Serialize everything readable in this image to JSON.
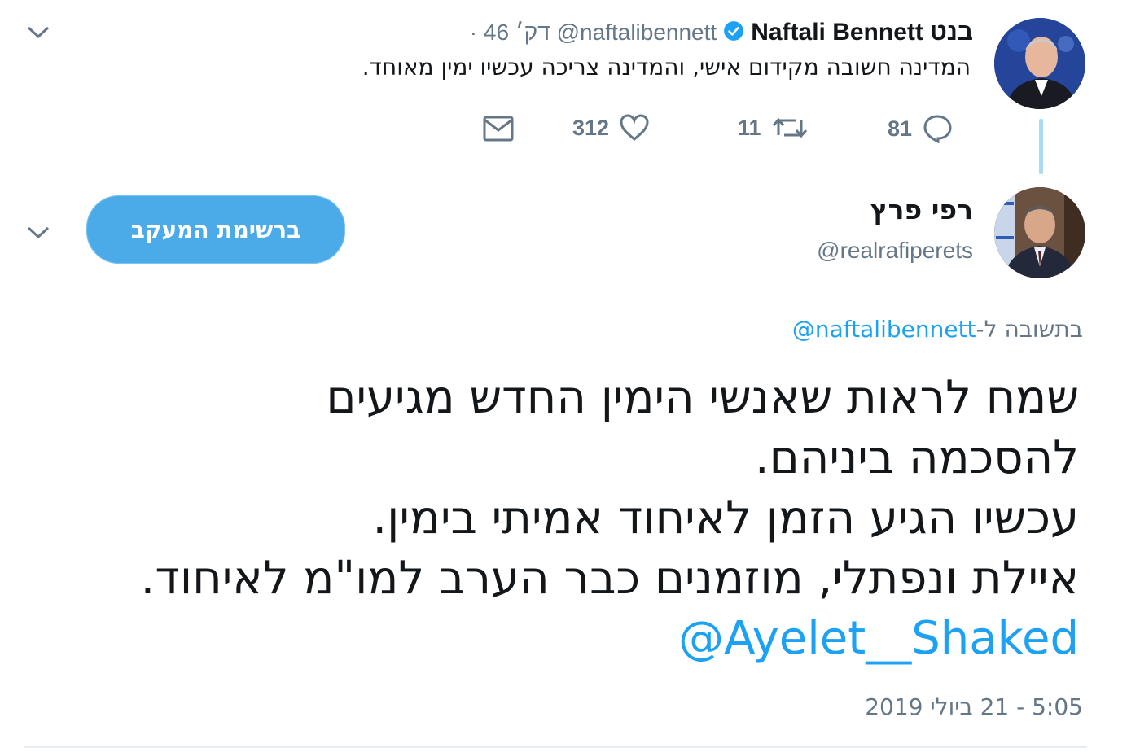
{
  "quoted_tweet": {
    "display_name": "Naftali Bennett בנט",
    "handle": "@naftalibennett",
    "time": "· 46 דק׳",
    "text": "המדינה חשובה מקידום אישי, והמדינה צריכה עכשיו ימין מאוחד.",
    "replies": "81",
    "retweets": "11",
    "likes": "312",
    "verified_icon": "verified-badge-icon"
  },
  "main_tweet": {
    "display_name": "רפי פרץ",
    "handle": "@realrafiperets",
    "follow_button": "ברשימת המעקב",
    "reply_prefix": "בתשובה ל-",
    "reply_to": "@naftalibennett",
    "lines": [
      "שמח לראות שאנשי הימין החדש מגיעים",
      "להסכמה ביניהם.",
      "עכשיו הגיע הזמן לאיחוד אמיתי בימין.",
      "איילת ונפתלי, מוזמנים כבר הערב למו\"מ לאיחוד."
    ],
    "mention": "@Ayelet__Shaked",
    "timestamp": "5:05 - 21 ביולי 2019"
  },
  "colors": {
    "link": "#1da1f2",
    "button": "#4aabe8",
    "muted": "#657786",
    "thread_line": "#a9dbf5"
  }
}
